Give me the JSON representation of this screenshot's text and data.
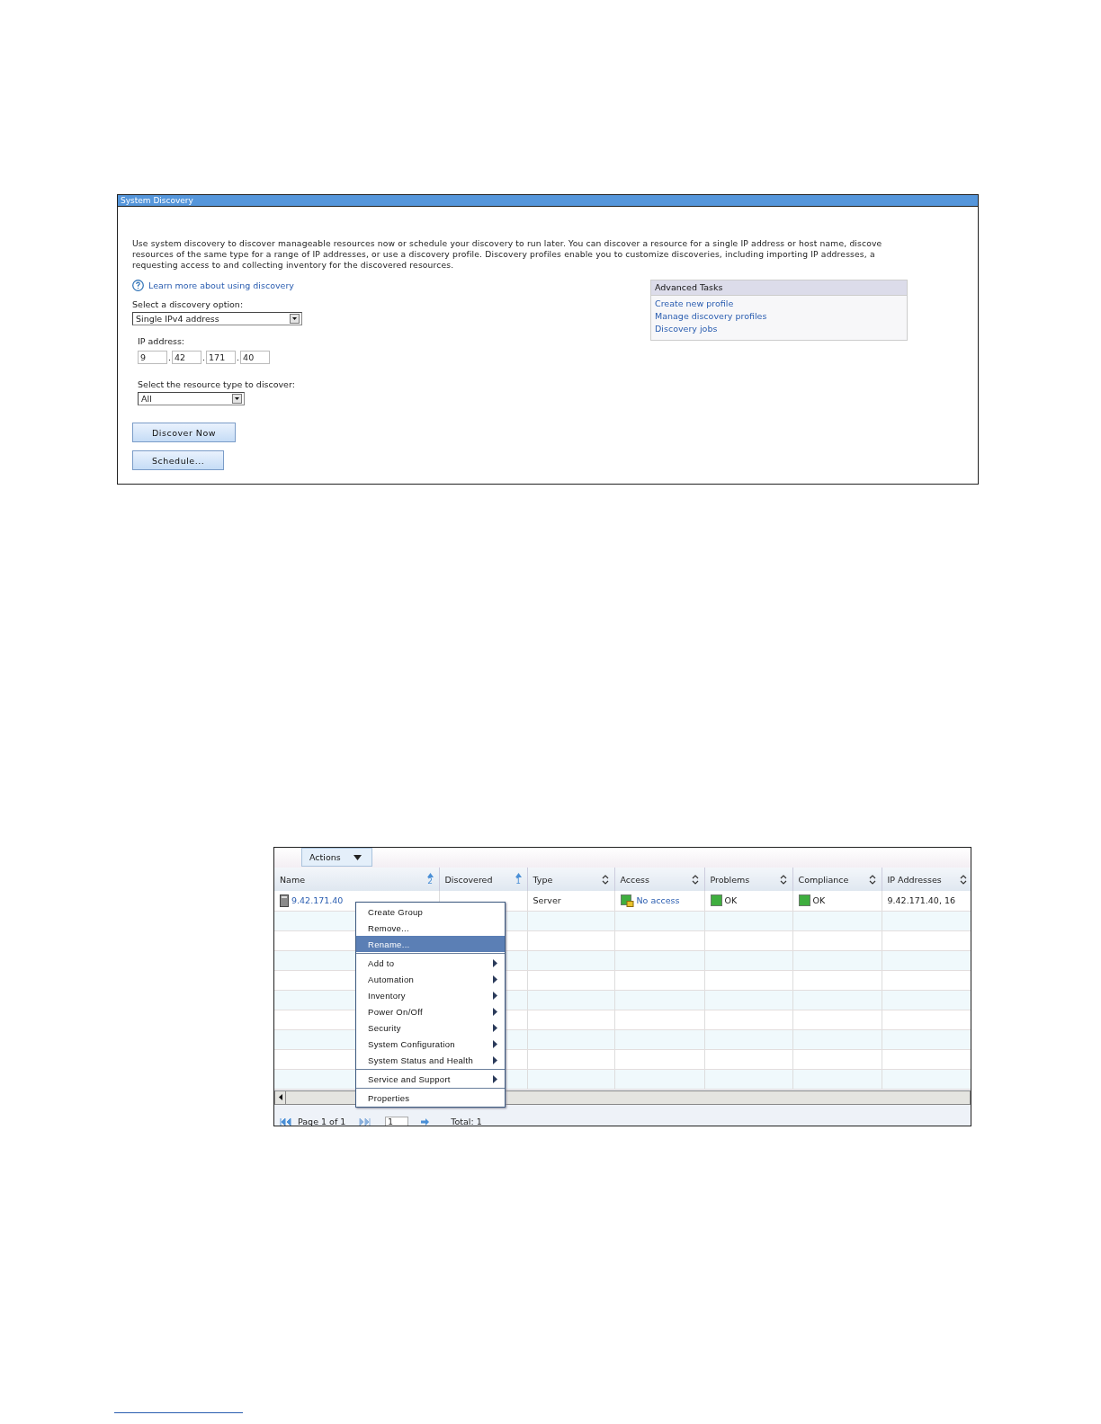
{
  "discovery_panel": {
    "title": "System Discovery",
    "description": [
      "Use system discovery to discover manageable resources now or schedule your discovery to run later. You can discover a resource for a single IP address or host name, discove",
      "resources of the same type for a range of IP addresses, or use a discovery profile. Discovery profiles enable you to customize discoveries, including importing IP addresses, a",
      "requesting access to and collecting inventory for the discovered resources."
    ],
    "help_link": "Learn more about using discovery",
    "discovery_option": {
      "label": "Select a discovery option:",
      "value": "Single IPv4 address"
    },
    "ip_address": {
      "label": "IP address:",
      "octets": [
        "9",
        "42",
        "171",
        "40"
      ],
      "separators": [
        ".",
        ".",
        "."
      ]
    },
    "resource_type": {
      "label": "Select the resource type to discover:",
      "value": "All"
    },
    "buttons": [
      "Discover Now",
      "Schedule..."
    ],
    "advanced_tasks": {
      "title": "Advanced Tasks",
      "links": [
        "Create new profile",
        "Manage discovery profiles",
        "Discovery jobs"
      ]
    }
  },
  "resources_panel": {
    "actions_button": "Actions",
    "columns": [
      {
        "label": "Name",
        "sort_order": "2"
      },
      {
        "label": "Discovered",
        "sort_order": "1"
      },
      {
        "label": "Type"
      },
      {
        "label": "Access"
      },
      {
        "label": "Problems"
      },
      {
        "label": "Compliance"
      },
      {
        "label": "IP Addresses"
      }
    ],
    "rows": [
      {
        "name": "9.42.171.40",
        "type": "Server",
        "access": "No access",
        "problems": "OK",
        "compliance": "OK",
        "ip_addresses": "9.42.171.40, 16"
      }
    ],
    "context_menu": {
      "groups": [
        [
          {
            "label": "Create Group",
            "submenu": false,
            "selected": false
          },
          {
            "label": "Remove...",
            "submenu": false,
            "selected": false
          },
          {
            "label": "Rename...",
            "submenu": false,
            "selected": true
          }
        ],
        [
          {
            "label": "Add to",
            "submenu": true,
            "selected": false
          },
          {
            "label": "Automation",
            "submenu": true,
            "selected": false
          },
          {
            "label": "Inventory",
            "submenu": true,
            "selected": false
          },
          {
            "label": "Power On/Off",
            "submenu": true,
            "selected": false
          },
          {
            "label": "Security",
            "submenu": true,
            "selected": false
          },
          {
            "label": "System Configuration",
            "submenu": true,
            "selected": false
          },
          {
            "label": "System Status and Health",
            "submenu": true,
            "selected": false
          }
        ],
        [
          {
            "label": "Service and Support",
            "submenu": true,
            "selected": false
          }
        ],
        [
          {
            "label": "Properties",
            "submenu": false,
            "selected": false
          }
        ]
      ]
    },
    "pager": {
      "page_label": "Page 1 of 1",
      "page_input": "1",
      "total": "Total: 1"
    }
  }
}
